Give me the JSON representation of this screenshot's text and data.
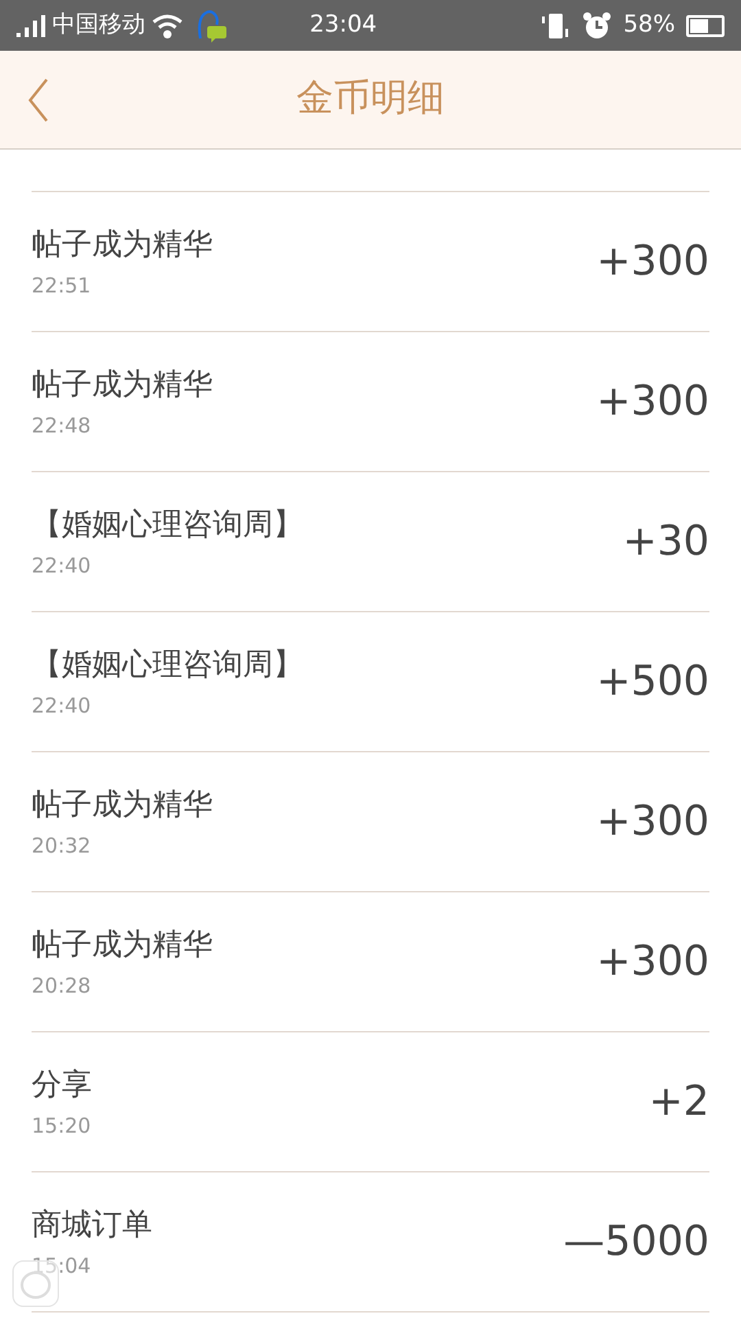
{
  "status_bar": {
    "carrier": "中国移动",
    "time": "23:04",
    "battery": "58%"
  },
  "header": {
    "title": "金币明细"
  },
  "records": [
    {
      "title": "帖子成为精华",
      "time": "22:51",
      "amount": "+300"
    },
    {
      "title": "帖子成为精华",
      "time": "22:48",
      "amount": "+300"
    },
    {
      "title": "【婚姻心理咨询周】",
      "time": "22:40",
      "amount": "+30"
    },
    {
      "title": "【婚姻心理咨询周】",
      "time": "22:40",
      "amount": "+500"
    },
    {
      "title": "帖子成为精华",
      "time": "20:32",
      "amount": "+300"
    },
    {
      "title": "帖子成为精华",
      "time": "20:28",
      "amount": "+300"
    },
    {
      "title": "分享",
      "time": "15:20",
      "amount": "+2"
    },
    {
      "title": "商城订单",
      "time": "15:04",
      "amount": "—5000"
    }
  ]
}
